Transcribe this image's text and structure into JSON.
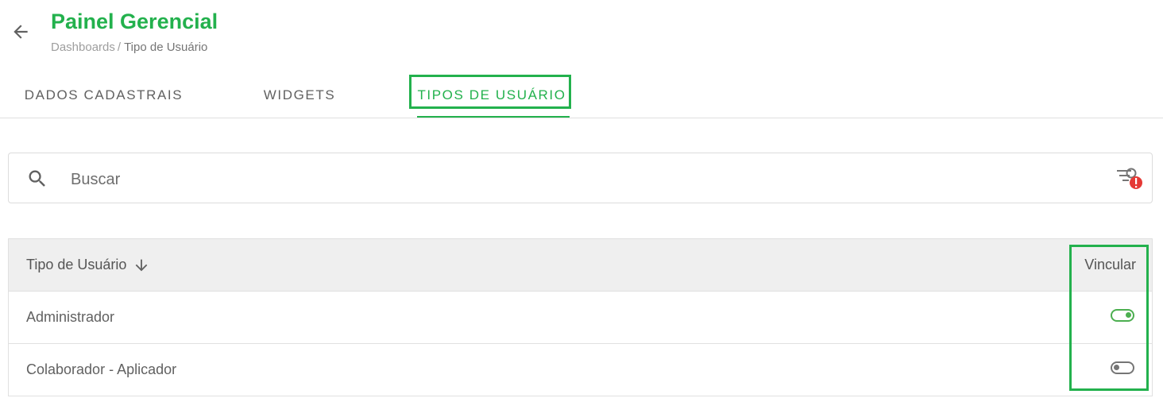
{
  "header": {
    "title": "Painel Gerencial",
    "breadcrumb": {
      "parent": "Dashboards",
      "separator": "/",
      "current": "Tipo de Usuário"
    }
  },
  "tabs": [
    {
      "label": "DADOS CADASTRAIS",
      "active": false
    },
    {
      "label": "WIDGETS",
      "active": false
    },
    {
      "label": "TIPOS DE USUÁRIO",
      "active": true
    }
  ],
  "search": {
    "placeholder": "Buscar",
    "value": ""
  },
  "table": {
    "columns": {
      "tipo": "Tipo de Usuário",
      "vincular": "Vincular"
    },
    "sort": "descending",
    "rows": [
      {
        "tipo": "Administrador",
        "vincular": true
      },
      {
        "tipo": "Colaborador - Aplicador",
        "vincular": false
      }
    ]
  },
  "colors": {
    "accent": "#23b14d",
    "toggle_on": "#4caf50",
    "toggle_off": "#757575",
    "alert": "#e53935"
  },
  "icons": {
    "back": "arrow-left-icon",
    "search": "search-icon",
    "filter": "filter-alert-icon",
    "sort": "arrow-down-icon"
  }
}
